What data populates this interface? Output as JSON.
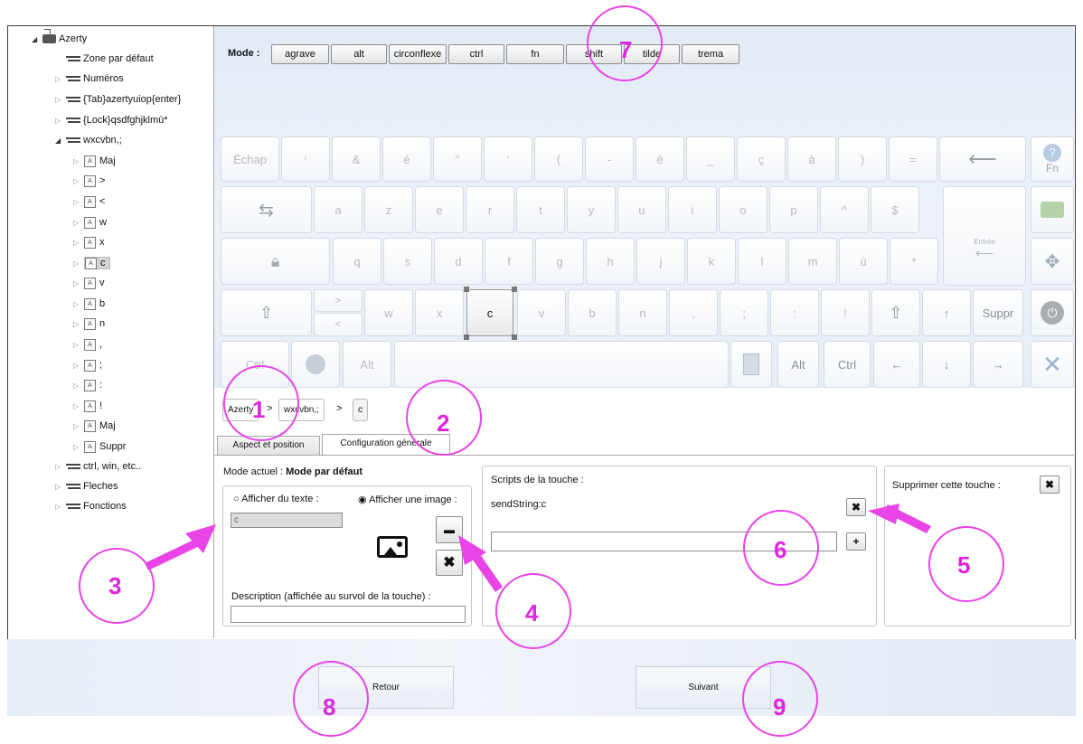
{
  "tree": {
    "root": "Azerty",
    "items": [
      {
        "label": "Zone par défaut"
      },
      {
        "label": "Numéros"
      },
      {
        "label": "{Tab}azertyuiop{enter}"
      },
      {
        "label": "{Lock}qsdfghjklmù*"
      },
      {
        "label": "wxcvbn,;"
      },
      {
        "label": "ctrl, win, etc.."
      },
      {
        "label": "Fleches"
      },
      {
        "label": "Fonctions"
      }
    ],
    "children": [
      "Maj",
      ">",
      "<",
      "w",
      "x",
      "c",
      "v",
      "b",
      "n",
      ",",
      ";",
      ":",
      "!",
      "Maj",
      "Suppr"
    ]
  },
  "mode": {
    "label": "Mode :",
    "buttons": [
      "agrave",
      "alt",
      "circonflexe",
      "ctrl",
      "fn",
      "shift",
      "tilde",
      "trema"
    ]
  },
  "keyboard": {
    "row1": [
      "Échap",
      "²",
      "&",
      "é",
      "\"",
      "'",
      "(",
      "-",
      "è",
      "_",
      "ç",
      "à",
      ")",
      "="
    ],
    "row2": [
      "a",
      "z",
      "e",
      "r",
      "t",
      "y",
      "u",
      "i",
      "o",
      "p",
      "^",
      "$"
    ],
    "row3": [
      "q",
      "s",
      "d",
      "f",
      "g",
      "h",
      "j",
      "k",
      "l",
      "m",
      "ù",
      "*"
    ],
    "row4": [
      "w",
      "x",
      "c",
      "v",
      "b",
      "n",
      ",",
      ";",
      ":",
      "!"
    ],
    "shift_top": ">",
    "shift_bottom": "<",
    "enter_label": "Entrée",
    "fn_label": "Fn",
    "suppr_label": "Suppr",
    "ctrl_label": "Ctrl",
    "alt_label": "Alt",
    "alt2_label": "Alt",
    "ctrl2_label": "Ctrl",
    "up_arrow": "↑",
    "left_arrow": "←",
    "down_arrow": "↓",
    "right_arrow": "→"
  },
  "breadcrumb": {
    "items": [
      "Azerty",
      "wxcvbn,;",
      "c"
    ],
    "separator": ">"
  },
  "tabs": [
    "Aspect et position",
    "Configuration générale"
  ],
  "config": {
    "mode_actuel_label": "Mode actuel :",
    "mode_actuel_value": "Mode par défaut",
    "afficher_texte": "Afficher du texte :",
    "afficher_image": "Afficher une image :",
    "text_value": "c",
    "description_label": "Description (affichée au survol de la touche) :",
    "description_value": "",
    "scripts_label": "Scripts de la touche :",
    "script_value": "sendString:c",
    "script_input": "",
    "supprimer_label": "Supprimer cette touche :"
  },
  "nav": {
    "back": "Retour",
    "next": "Suivant"
  },
  "annotations": [
    "1",
    "2",
    "3",
    "4",
    "5",
    "6",
    "7",
    "8",
    "9"
  ],
  "colors": {
    "annotation": "#e024e0",
    "panel_bg": "#e6edf5"
  }
}
